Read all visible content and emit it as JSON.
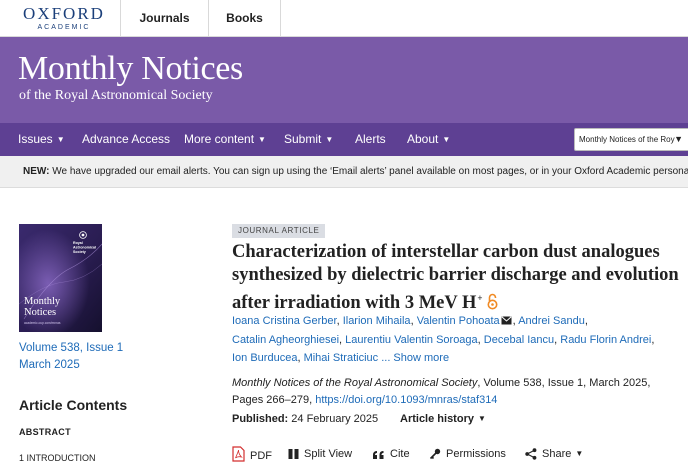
{
  "brand": {
    "logo": "OXFORD",
    "logo_sub": "ACADEMIC"
  },
  "top_nav": {
    "journals": "Journals",
    "books": "Books"
  },
  "banner": {
    "title": "Monthly Notices",
    "subtitle": "of the Royal Astronomical Society"
  },
  "nav": {
    "issues": "Issues",
    "advance_access": "Advance Access",
    "more_content": "More content",
    "submit": "Submit",
    "alerts": "Alerts",
    "about": "About",
    "journal_select": "Monthly Notices of the Roy"
  },
  "notice": {
    "label": "NEW:",
    "text": "We have upgraded our email alerts. You can sign up using the ‘Email alerts’ panel available on most pages, or in your Oxford Academic personal a"
  },
  "cover": {
    "society": [
      "Royal",
      "Astronomical",
      "Society"
    ],
    "title": [
      "Monthly",
      "Notices"
    ],
    "tagline": "academic.oup.com/mnras"
  },
  "sidebar": {
    "issue_link": "Volume 538, Issue 1 March 2025",
    "contents_heading": "Article Contents",
    "toc": [
      "ABSTRACT",
      "1 INTRODUCTION"
    ]
  },
  "article": {
    "type_badge": "JOURNAL ARTICLE",
    "title": "Characterization of interstellar carbon dust analogues synthesized by dielectric barrier discharge and evolution after irradiation with 3 MeV H",
    "title_sup": "+",
    "authors": [
      "Ioana Cristina Gerber",
      "Ilarion Mihaila",
      "Valentin Pohoata",
      "Andrei Sandu",
      "Catalin Agheorghiesei",
      "Laurentiu Valentin Soroaga",
      "Decebal Iancu",
      "Radu Florin Andrei",
      "Ion Burducea",
      "Mihai Straticiuc"
    ],
    "show_more": "... Show more",
    "journal_name": "Monthly Notices of the Royal Astronomical Society",
    "citation_rest": ", Volume 538, Issue 1, March 2025, Pages 266–279,",
    "doi": "https://doi.org/10.1093/mnras/staf314",
    "published_label": "Published:",
    "published_date": "24 February 2025",
    "history_label": "Article history"
  },
  "toolbar": {
    "pdf": "PDF",
    "split_view": "Split View",
    "cite": "Cite",
    "permissions": "Permissions",
    "share": "Share"
  },
  "colors": {
    "banner": "#7a5aa8",
    "nav": "#5e4093",
    "link": "#1e6bb8",
    "open_access": "#f08a24",
    "pdf_icon": "#d32f2f"
  },
  "icons": {
    "open_access": "open-access-lock-icon",
    "email": "envelope-icon",
    "pdf": "pdf-file-icon",
    "split_view": "split-view-icon",
    "cite": "quote-icon",
    "permissions": "key-icon"
  }
}
